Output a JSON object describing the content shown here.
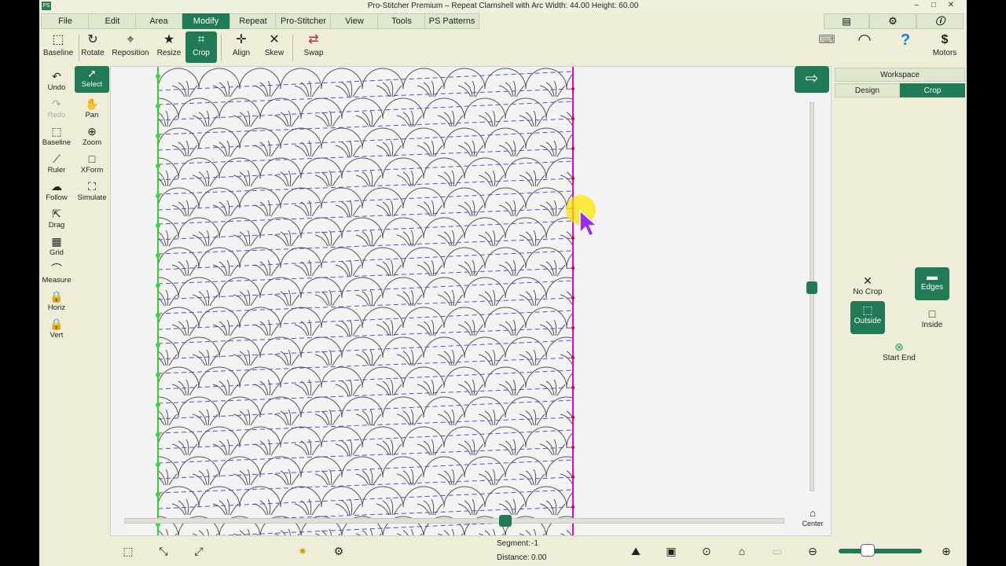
{
  "titlebar": {
    "app_icon": "PS",
    "title": "Pro-Stitcher Premium  –  Repeat Clamshell with Arc  Width: 44.00  Height: 60.00",
    "min": "–",
    "max": "□",
    "close": "✕"
  },
  "menu": {
    "tabs": [
      "File",
      "Edit",
      "Area",
      "Modify",
      "Repeat",
      "Pro-Stitcher",
      "View",
      "Tools",
      "PS Patterns"
    ],
    "active_index": 3
  },
  "toolbar": {
    "tools": [
      {
        "label": "Baseline",
        "icon": "baseline-icon"
      },
      {
        "label": "Rotate",
        "icon": "rotate-icon"
      },
      {
        "label": "Reposition",
        "icon": "reposition-icon"
      },
      {
        "label": "Resize",
        "icon": "resize-icon"
      },
      {
        "label": "Crop",
        "icon": "crop-icon"
      },
      {
        "label": "Align",
        "icon": "align-icon"
      },
      {
        "label": "Skew",
        "icon": "skew-icon"
      },
      {
        "label": "Swap",
        "icon": "swap-icon"
      }
    ],
    "active": "Crop",
    "motors_label": "Motors"
  },
  "left_tools": [
    {
      "label": "Undo",
      "icon": "undo-icon"
    },
    {
      "label": "Select",
      "icon": "select-icon"
    },
    {
      "label": "Redo",
      "icon": "redo-icon"
    },
    {
      "label": "Pan",
      "icon": "pan-icon"
    },
    {
      "label": "Baseline",
      "icon": "baseline-icon"
    },
    {
      "label": "Zoom",
      "icon": "zoom-icon"
    },
    {
      "label": "Ruler",
      "icon": "ruler-icon"
    },
    {
      "label": "XForm",
      "icon": "xform-icon"
    },
    {
      "label": "Follow",
      "icon": "follow-icon"
    },
    {
      "label": "Simulate",
      "icon": "simulate-icon"
    },
    {
      "label": "Drag",
      "icon": "drag-icon"
    },
    {
      "label": "Grid",
      "icon": "grid-icon"
    },
    {
      "label": "Measure",
      "icon": "measure-icon"
    },
    {
      "label": "Horiz",
      "icon": "lock-horizontal-icon"
    },
    {
      "label": "Vert",
      "icon": "lock-vertical-icon"
    }
  ],
  "right_panel": {
    "workspace_label": "Workspace",
    "tabs": [
      "Design",
      "Crop"
    ],
    "active_tab": "Crop",
    "crop_buttons": {
      "no_crop": "No Crop",
      "edges": "Edges",
      "outside": "Outside",
      "inside": "Inside",
      "start_end": "Start End"
    },
    "center_label": "Center"
  },
  "status": {
    "segment_label": "Segment:",
    "segment_value": "-1",
    "distance_label": "Distance:",
    "distance_value": "0.00"
  },
  "colors": {
    "accent": "#1f7a55",
    "crop_line": "#e000e0",
    "left_line": "#33cc33",
    "dash": "#5050c8",
    "pattern": "#555555"
  }
}
